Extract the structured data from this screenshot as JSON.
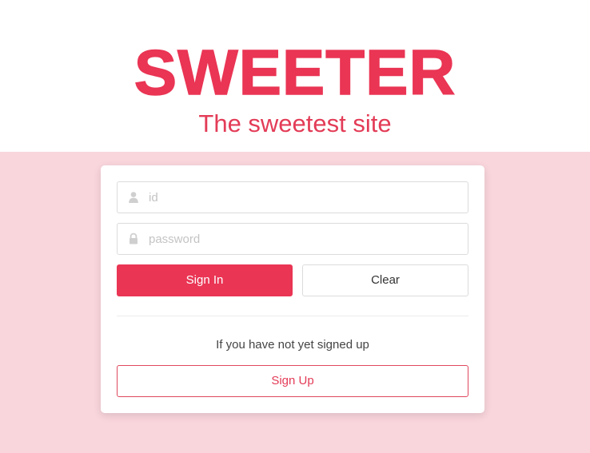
{
  "header": {
    "logo_text": "SWEETER",
    "tagline": "The sweetest site"
  },
  "login": {
    "id_placeholder": "id",
    "password_placeholder": "password",
    "signin_label": "Sign In",
    "clear_label": "Clear",
    "signup_prompt": "If you have not yet signed up",
    "signup_label": "Sign Up"
  },
  "icons": {
    "id_field": "user-icon",
    "password_field": "lock-icon"
  },
  "colors": {
    "brand": "#ea3554",
    "background_pink": "#f9d5dc",
    "card": "#ffffff"
  }
}
